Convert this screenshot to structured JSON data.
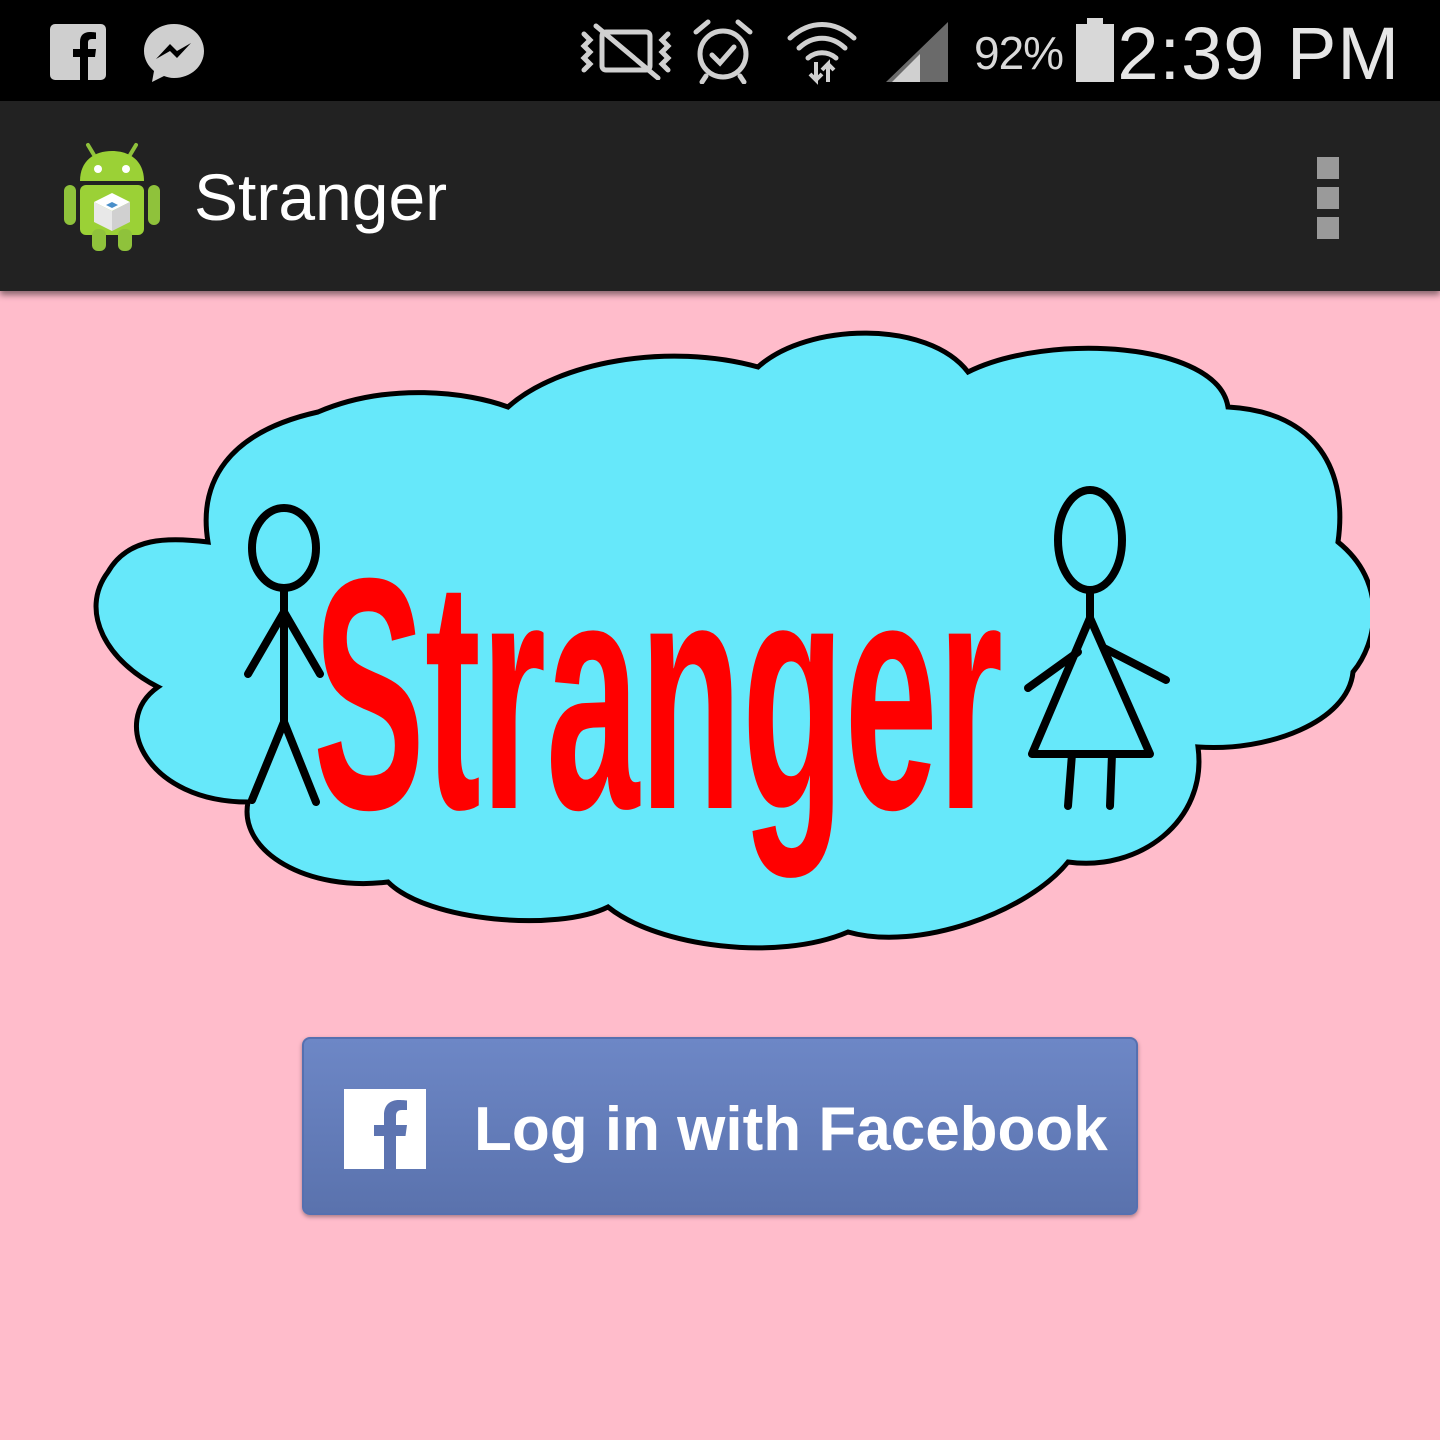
{
  "status_bar": {
    "battery_percent": "92%",
    "battery_level": 0.92,
    "time": "2:39 PM",
    "left_icons": [
      "facebook-icon",
      "messenger-icon"
    ],
    "right_icons": [
      "vibrate-mute-icon",
      "alarm-icon",
      "wifi-icon",
      "signal-icon",
      "battery-icon"
    ]
  },
  "action_bar": {
    "title": "Stranger",
    "app_icon": "android-app-icon",
    "menu_icon": "overflow-menu-icon"
  },
  "logo": {
    "text": "Stranger",
    "cloud_color": "#66e8fa",
    "text_color": "#ff0000",
    "figures": [
      "man-stick-figure",
      "woman-stick-figure"
    ]
  },
  "login": {
    "button_label": "Log in with Facebook",
    "button_icon": "facebook-icon",
    "button_color": "#6177b6"
  },
  "colors": {
    "background": "#ffbccb",
    "action_bar": "#222222",
    "status_bar": "#000000"
  }
}
